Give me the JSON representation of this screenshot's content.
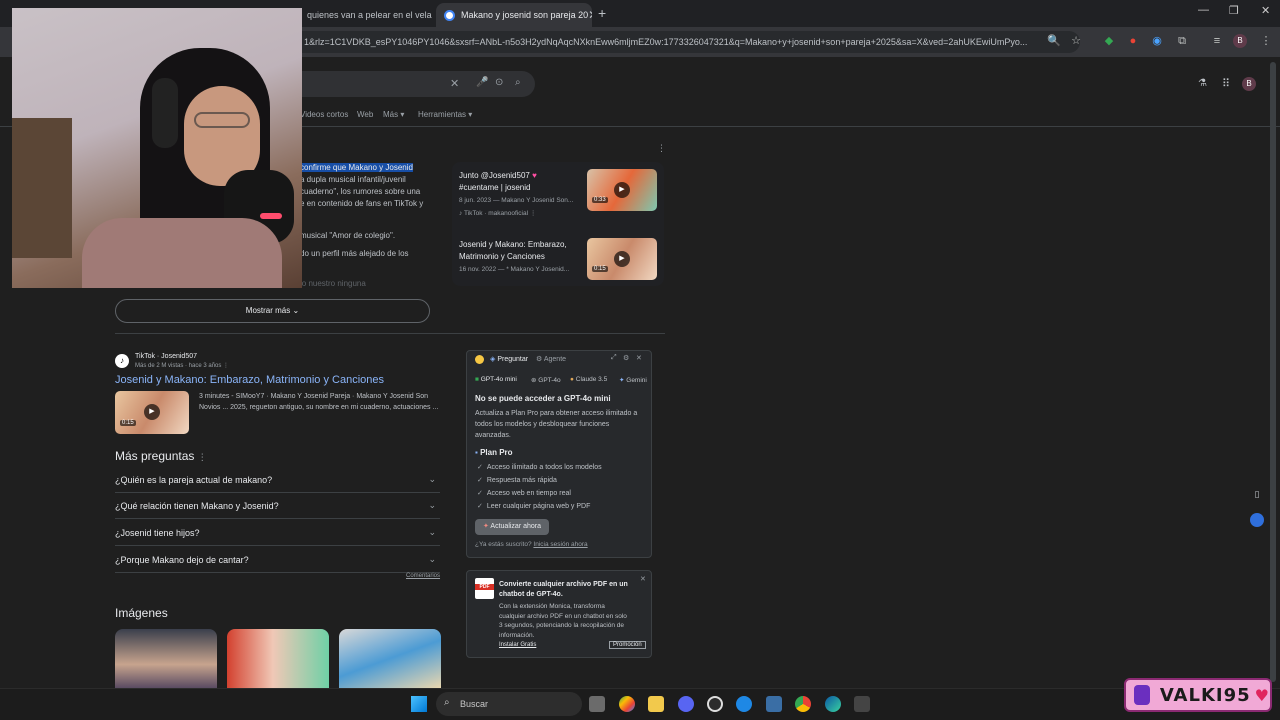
{
  "tabs": [
    {
      "label": "quienes van a pelear en el vela"
    },
    {
      "label": "Makano y josenid son pareja 20"
    }
  ],
  "address_bar": {
    "url": "1&rlz=1C1VDKB_esPY1046PY1046&sxsrf=ANbL-n5o3H2ydNqAqcNXknEww6mljmEZ0w:1773326047321&q=Makano+y+josenid+son+pareja+2025&sa=X&ved=2ahUKEwiUmPyo..."
  },
  "profile_initial": "B",
  "search_nav": {
    "items": [
      "Videos cortos",
      "Web",
      "Más",
      "Herramientas"
    ]
  },
  "ai_snippet": {
    "lines": [
      {
        "highlight": "confirme que Makano y Josenid",
        "text": ""
      },
      {
        "highlight": "",
        "text": "a dupla musical infantil/juvenil"
      },
      {
        "highlight": "",
        "text": "cuaderno\", los rumores sobre una"
      },
      {
        "highlight": "",
        "text": "e en contenido de fans en TikTok y"
      },
      {
        "highlight": "",
        "text": "musical \"Amor de colegio\"."
      },
      {
        "highlight": "",
        "text": "do un perfil más alejado de los"
      },
      {
        "highlight": "",
        "text": "lo nuestro ninguna"
      }
    ],
    "show_more": "Mostrar más"
  },
  "video_card": {
    "items": [
      {
        "title_line1": "Junto @Josenid507",
        "title_line2": "#cuentame | josenid",
        "meta": "8 jun. 2023 — Makano Y Josenid Son...",
        "source": "TikTok · makanooficial",
        "duration": "0:33"
      },
      {
        "title_line1": "Josenid y Makano: Embarazo,",
        "title_line2": "Matrimonio y Canciones",
        "meta": "16 nov. 2022 — * Makano Y Josenid...",
        "source": "",
        "duration": "0:15"
      }
    ]
  },
  "tiktok_result": {
    "site": "TikTok · Josenid507",
    "views": "Más de 2 M vistas · hace 3 años",
    "title": "Josenid y Makano: Embarazo, Matrimonio y Canciones",
    "desc_line1": "3 minutes - SIMooY7 · Makano Y Josenid Pareja · Makano Y Josenid Son",
    "desc_line2": "Novios ... 2025, regueton antiguo, su nombre en mi cuaderno, actuaciones ...",
    "duration": "0:15"
  },
  "paa": {
    "heading": "Más preguntas",
    "questions": [
      "¿Quién es la pareja actual de makano?",
      "¿Qué relación tienen Makano y Josenid?",
      "¿Josenid tiene hijos?",
      "¿Porque Makano dejo de cantar?"
    ],
    "feedback": "Comentarios"
  },
  "images_heading": "Imágenes",
  "monica": {
    "tabs": [
      "Preguntar",
      "Agente"
    ],
    "models": [
      "GPT-4o mini",
      "GPT-4o",
      "Claude 3.5",
      "Gemini"
    ],
    "error_title": "No se puede acceder a GPT-4o mini",
    "desc_line1": "Actualiza a Plan Pro para obtener acceso ilimitado a",
    "desc_line2": "todos los modelos y desbloquear funciones",
    "desc_line3": "avanzadas.",
    "plan_title": "Plan Pro",
    "features": [
      "Acceso ilimitado a todos los modelos",
      "Respuesta más rápida",
      "Acceso web en tiempo real",
      "Leer cualquier página web y PDF"
    ],
    "upgrade": "Actualizar ahora",
    "subscribed": "¿Ya estás suscrito?",
    "login": "Inicia sesión ahora"
  },
  "pdf_promo": {
    "icon_text": "PDF",
    "title_line1": "Convierte cualquier archivo PDF en un",
    "title_line2": "chatbot de GPT-4o.",
    "body_line1": "Con la extensión Monica, transforma",
    "body_line2": "cualquier archivo PDF en un chatbot en solo",
    "body_line3": "3 segundos, potenciando la recopilación de",
    "body_line4": "información.",
    "install": "Instalar Gratis",
    "badge": "Promoción"
  },
  "taskbar": {
    "search": "Buscar"
  },
  "twitch": {
    "handle": "VALKI95"
  }
}
